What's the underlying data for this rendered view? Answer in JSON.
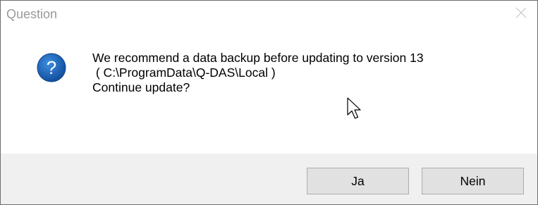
{
  "window": {
    "title": "Question"
  },
  "message": {
    "line1": "We recommend a data backup before updating to version 13",
    "line2": " ( C:\\ProgramData\\Q-DAS\\Local )",
    "line3": "Continue update?"
  },
  "icon": {
    "type": "question-icon",
    "glyph": "?",
    "color": "#1a5fb4"
  },
  "buttons": {
    "yes_label": "Ja",
    "no_label": "Nein"
  }
}
